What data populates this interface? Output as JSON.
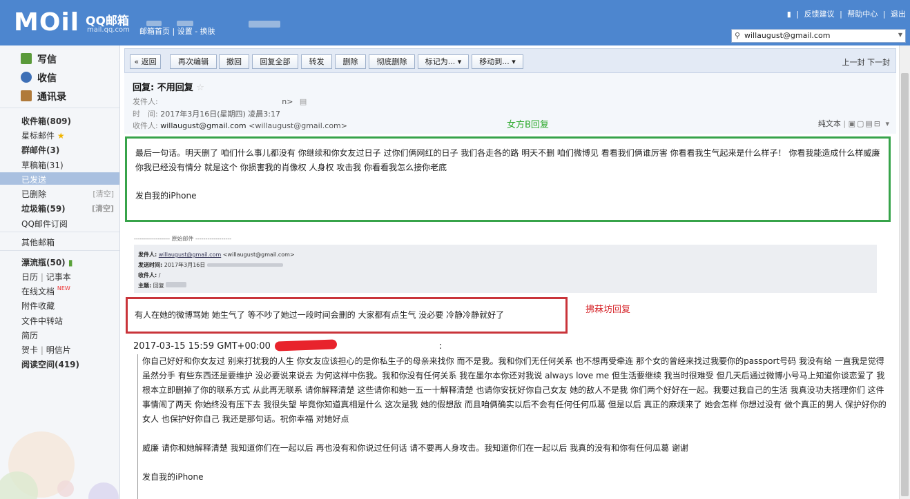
{
  "header": {
    "logo": "MOil",
    "logo_cn": "QQ邮箱",
    "logo_domain": "mail.qq.com",
    "home_link": "邮箱首页",
    "settings_link": "设置",
    "skin_link": "换肤",
    "feedback": "反馈建议",
    "help": "帮助中心",
    "logout": "退出",
    "account": "willaugust@gmail.com"
  },
  "sidebar": {
    "compose": "写信",
    "inbox": "收信",
    "contacts": "通讯录",
    "folders": {
      "inbox_box": "收件箱(809)",
      "starred": "星标邮件",
      "group": "群邮件(3)",
      "drafts": "草稿箱(31)",
      "sent": "已发送",
      "deleted": "已删除",
      "spam": "垃圾箱(59)",
      "subscribe": "QQ邮件订阅",
      "other": "其他邮箱",
      "drift": "漂流瓶(50)",
      "calendar": "日历",
      "notes": "记事本",
      "docs": "在线文档",
      "docs_new": "NEW",
      "attachments": "附件收藏",
      "transfer": "文件中转站",
      "resume": "简历",
      "cards": "贺卡",
      "postcards": "明信片",
      "reading": "阅读空间(419)",
      "clear": "[清空]"
    }
  },
  "toolbar": {
    "back": "« 返回",
    "reedit": "再次编辑",
    "recall": "撤回",
    "reply_all": "回复全部",
    "forward": "转发",
    "delete": "删除",
    "perm_delete": "彻底删除",
    "mark_as": "标记为... ▾",
    "move_to": "移动到... ▾",
    "prev": "上一封",
    "next": "下一封"
  },
  "mail": {
    "subject": "回复: 不用回复",
    "from_label": "发件人:",
    "from_tail": "n>",
    "time_label": "时　间:",
    "time_value": "2017年3月16日(星期四) 凌晨3:17",
    "to_label": "收件人:",
    "to_value": "willaugust@gmail.com",
    "to_addr": "<willaugust@gmail.com>",
    "plaintext": "纯文本",
    "annotation_girl": "女方B回复",
    "reply_text": "最后一句话。明天删了 咱们什么事儿都没有 你继续和你女友过日子 过你们俩网红的日子 我们各走各的路  明天不删 咱们微博见 看看我们俩谁厉害 你看看我生气起来是什么样子！ 你看我能造成什么样威廉 你我已经没有情分 就是这个 你损害我的肖像权 人身权 攻击我 你看看我怎么接你老底",
    "signature": "发自我的iPhone"
  },
  "original": {
    "separator": "------------------ 原始邮件 ------------------",
    "from_label": "发件人:",
    "from_value": "willaugust@gmail.com",
    "from_addr": "<willaugust@gmail.com>",
    "sent_label": "发送时间:",
    "sent_value": "2017年3月16日",
    "to_label": "收件人:",
    "to_value": "/",
    "subject_label": "主题:",
    "subject_value": "回复"
  },
  "william_reply": "有人在她的微博骂她 她生气了 等不吵了她过一段时间会删的 大家都有点生气 没必要 冷静冷静就好了",
  "annotation_third": "拂菻坊回复",
  "quote": {
    "date_line": "2017-03-15 15:59 GMT+00:00",
    "colon": ":",
    "para1": "你自己好好和你女友过 别来打扰我的人生 你女友应该担心的是你私生子的母亲来找你 而不是我。我和你们无任何关系 也不想再受牵连 那个女的曾经来找过我要你的passport号码 我没有给 一直我是觉得虽然分手 有些东西还是要维护 没必要说来说去 为何这样中伤我。我和你没有任何关系 我在墨尔本你还对我说 always love me 但生活要继续 我当时很难受 但几天后通过微博小号马上知道你谈恋爱了 我根本立即删掉了你的联系方式  从此再无联系 请你解释清楚 这些请你和她一五一十解释清楚 也请你安抚好你自己女友 她的敌人不是我  你们两个好好在一起。我要过我自己的生活 我真没功夫搭理你们  这件事情闹了两天 你始终没有压下去 我很失望 毕竟你知道真相是什么 这次是我 她的假想敌 而且咱俩确实以后不会有任何任何瓜葛  但是以后 真正的麻烦来了 她会怎样 你想过没有 做个真正的男人 保护好你的女人 也保护好你自己 我还是那句话。祝你幸福 对她好点",
    "para2": "威廉 请你和她解释清楚 我知道你们在一起以后 再也没有和你说过任何话  请不要再人身攻击。我知道你们在一起以后 我真的没有和你有任何瓜葛 谢谢",
    "signature": "发自我的iPhone"
  },
  "colors": {
    "header_blue": "#4d86cf",
    "green_box": "#37a34a",
    "red_box": "#c9343a",
    "selected_folder": "#a9c0e0"
  }
}
